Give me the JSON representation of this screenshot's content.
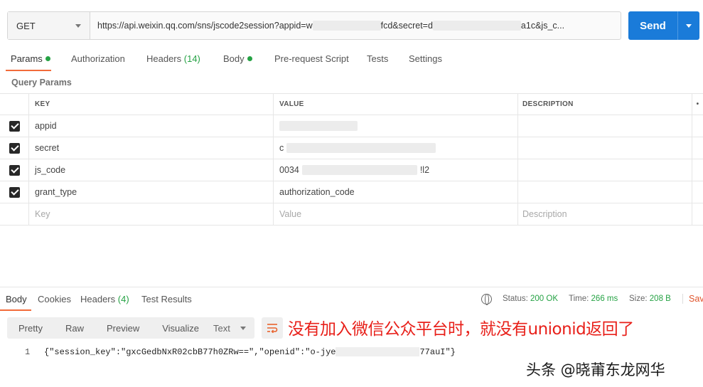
{
  "request": {
    "method": "GET",
    "url_parts": [
      "https://api.weixin.qq.com/sns/jscode2session?appid=w",
      "fcd&secret=d",
      "a1c&js_c..."
    ],
    "send_label": "Send"
  },
  "request_tabs": [
    {
      "label": "Params",
      "dot": true
    },
    {
      "label": "Authorization"
    },
    {
      "label": "Headers",
      "count": "(14)"
    },
    {
      "label": "Body",
      "dot": true
    },
    {
      "label": "Pre-request Script"
    },
    {
      "label": "Tests"
    },
    {
      "label": "Settings"
    }
  ],
  "query_params_title": "Query Params",
  "params_table": {
    "headers": {
      "key": "KEY",
      "value": "VALUE",
      "description": "DESCRIPTION",
      "more": "•"
    },
    "rows": [
      {
        "key": "appid",
        "value": "",
        "checked": true
      },
      {
        "key": "secret",
        "value": "c",
        "checked": true
      },
      {
        "key": "js_code",
        "value": "0034",
        "value_end": "!l2",
        "checked": true
      },
      {
        "key": "grant_type",
        "value": "authorization_code",
        "checked": true
      }
    ],
    "placeholder": {
      "key": "Key",
      "value": "Value",
      "description": "Description"
    }
  },
  "response_tabs": [
    {
      "label": "Body"
    },
    {
      "label": "Cookies"
    },
    {
      "label": "Headers",
      "count": "(4)"
    },
    {
      "label": "Test Results"
    }
  ],
  "response_status": {
    "status_label": "Status:",
    "status_value": "200 OK",
    "time_label": "Time:",
    "time_value": "266 ms",
    "size_label": "Size:",
    "size_value": "208 B",
    "save_label": "Sav"
  },
  "format_buttons": [
    "Pretty",
    "Raw",
    "Preview",
    "Visualize"
  ],
  "format_type": "Text",
  "annotation": "没有加入微信公众平台时，就没有unionid返回了",
  "response_body": {
    "line_number": "1",
    "code_start": "{\"session_key\":\"gxcGedbNxR02cbB77h0ZRw==\",\"openid\":\"o-jye",
    "code_end": "77auI\"}"
  },
  "watermark": "头条 @晓莆东龙网华",
  "colors": {
    "accent": "#f26b3a",
    "send": "#1a7bd9",
    "status_green": "#25a244",
    "annotation_red": "#e8201a"
  }
}
